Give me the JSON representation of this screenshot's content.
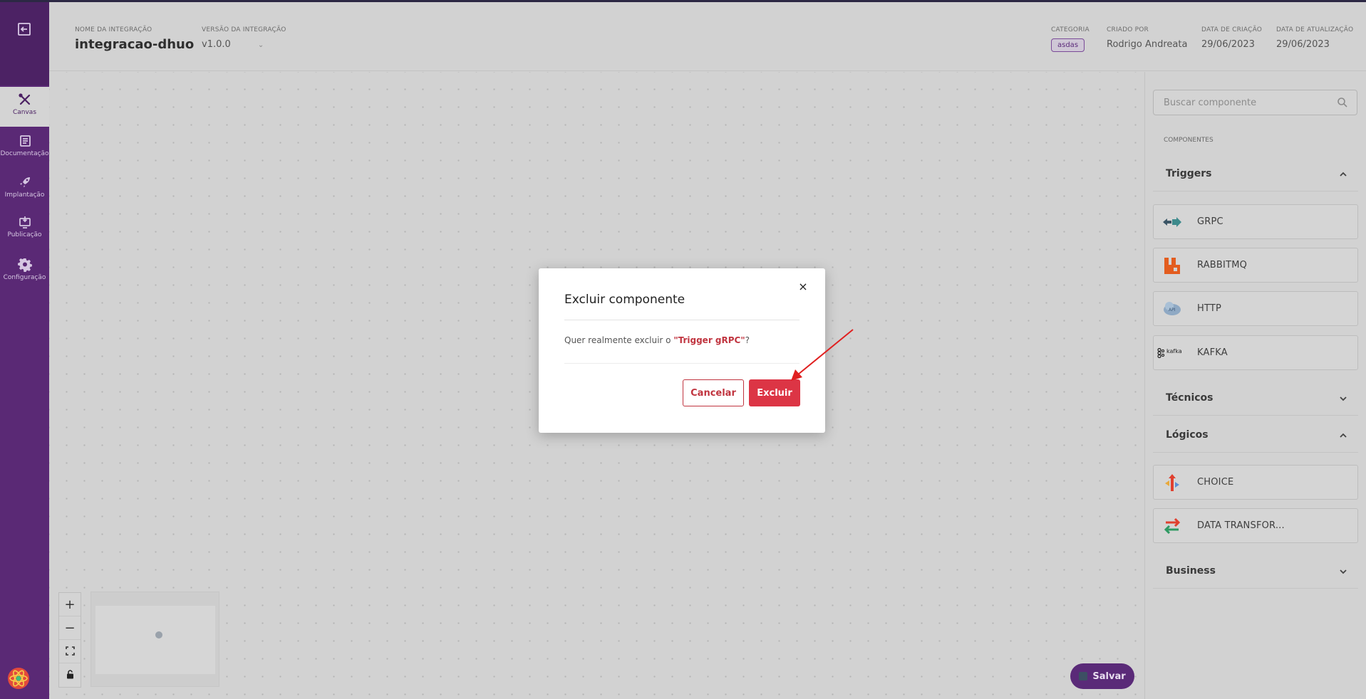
{
  "sidebar": {
    "items": [
      {
        "label": "Canvas",
        "icon": "canvas-tools-icon",
        "active": true
      },
      {
        "label": "Documentação",
        "icon": "book-icon",
        "active": false
      },
      {
        "label": "Implantação",
        "icon": "rocket-icon",
        "active": false
      },
      {
        "label": "Publicação",
        "icon": "publish-icon",
        "active": false
      },
      {
        "label": "Configuração",
        "icon": "gear-icon",
        "active": false
      }
    ]
  },
  "header": {
    "integration_name_caption": "NOME DA INTEGRAÇÃO",
    "integration_name": "integracao-dhuo",
    "version_caption": "VERSÃO DA INTEGRAÇÃO",
    "version": "v1.0.0",
    "category_caption": "CATEGORIA",
    "category": "asdas",
    "created_by_caption": "CRIADO POR",
    "created_by": "Rodrigo Andreata",
    "created_date_caption": "DATA DE CRIAÇÃO",
    "created_date": "29/06/2023",
    "updated_date_caption": "DATA DE ATUALIZAÇÃO",
    "updated_date": "29/06/2023"
  },
  "canvas": {
    "save_label": "Salvar"
  },
  "panel": {
    "search_placeholder": "Buscar componente",
    "components_title": "COMPONENTES",
    "sections": {
      "triggers": "Triggers",
      "tecnicos": "Técnicos",
      "logicos": "Lógicos",
      "business": "Business"
    },
    "triggers": [
      "GRPC",
      "RABBITMQ",
      "HTTP",
      "KAFKA"
    ],
    "logicos": [
      "CHOICE",
      "DATA TRANSFOR..."
    ],
    "kafka_logo_text": "kafka"
  },
  "modal": {
    "title": "Excluir componente",
    "message_prefix": "Quer realmente excluir o ",
    "message_highlight": "\"Trigger gRPC\"",
    "message_suffix": "?",
    "cancel_label": "Cancelar",
    "delete_label": "Excluir",
    "close_symbol": "×"
  },
  "colors": {
    "sidebar": "#5a2975",
    "primary": "#5a2a78",
    "danger": "#dc3545",
    "annotation_arrow": "#e02020"
  }
}
